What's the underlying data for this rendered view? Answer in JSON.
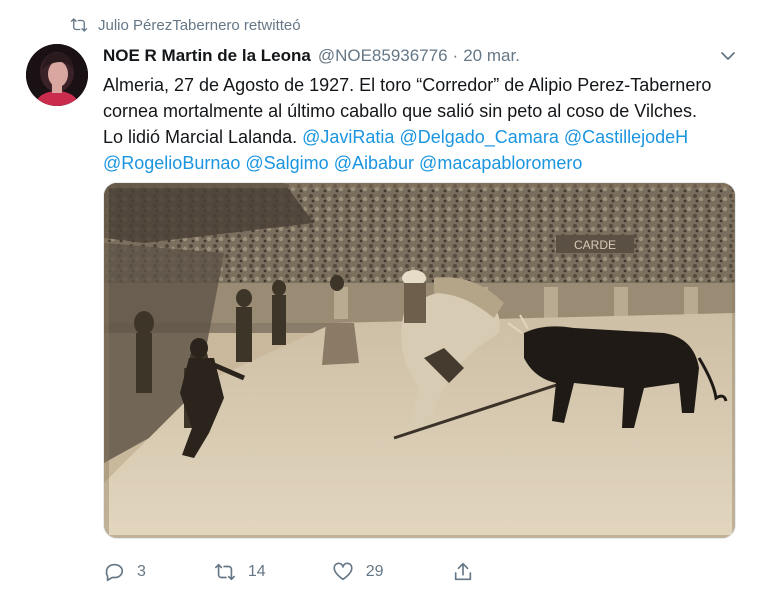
{
  "retweet_context": {
    "icon": "retweet-icon",
    "text": "Julio PérezTabernero retwitteó"
  },
  "tweet": {
    "display_name": "NOE R Martin de la Leona",
    "handle": "@NOE85936776",
    "separator": "·",
    "time": "20 mar.",
    "text_lines": [
      "Almeria, 27 de Agosto de 1927. El toro “Corredor” de Alipio Perez-Tabernero",
      "cornea mortalmente al último caballo que salió sin peto al coso de Vilches.",
      "Lo lidió Marcial Lalanda."
    ],
    "mentions": [
      "@JaviRatia",
      "@Delgado_Camara",
      "@CastillejodeH",
      "@RogelioBurnao",
      "@Salgimo",
      "@Aibabur",
      "@macapabloromero"
    ]
  },
  "media": {
    "photo_banner_text": "CARDE"
  },
  "actions": {
    "reply": {
      "icon": "reply-icon",
      "count": "3"
    },
    "retweet": {
      "icon": "retweet-icon",
      "count": "14"
    },
    "like": {
      "icon": "heart-icon",
      "count": "29"
    },
    "share": {
      "icon": "share-icon"
    }
  },
  "colors": {
    "link": "#1b95e0",
    "secondary_text": "#657786",
    "primary_text": "#14171a",
    "photo_tone": "#c9b89c"
  }
}
